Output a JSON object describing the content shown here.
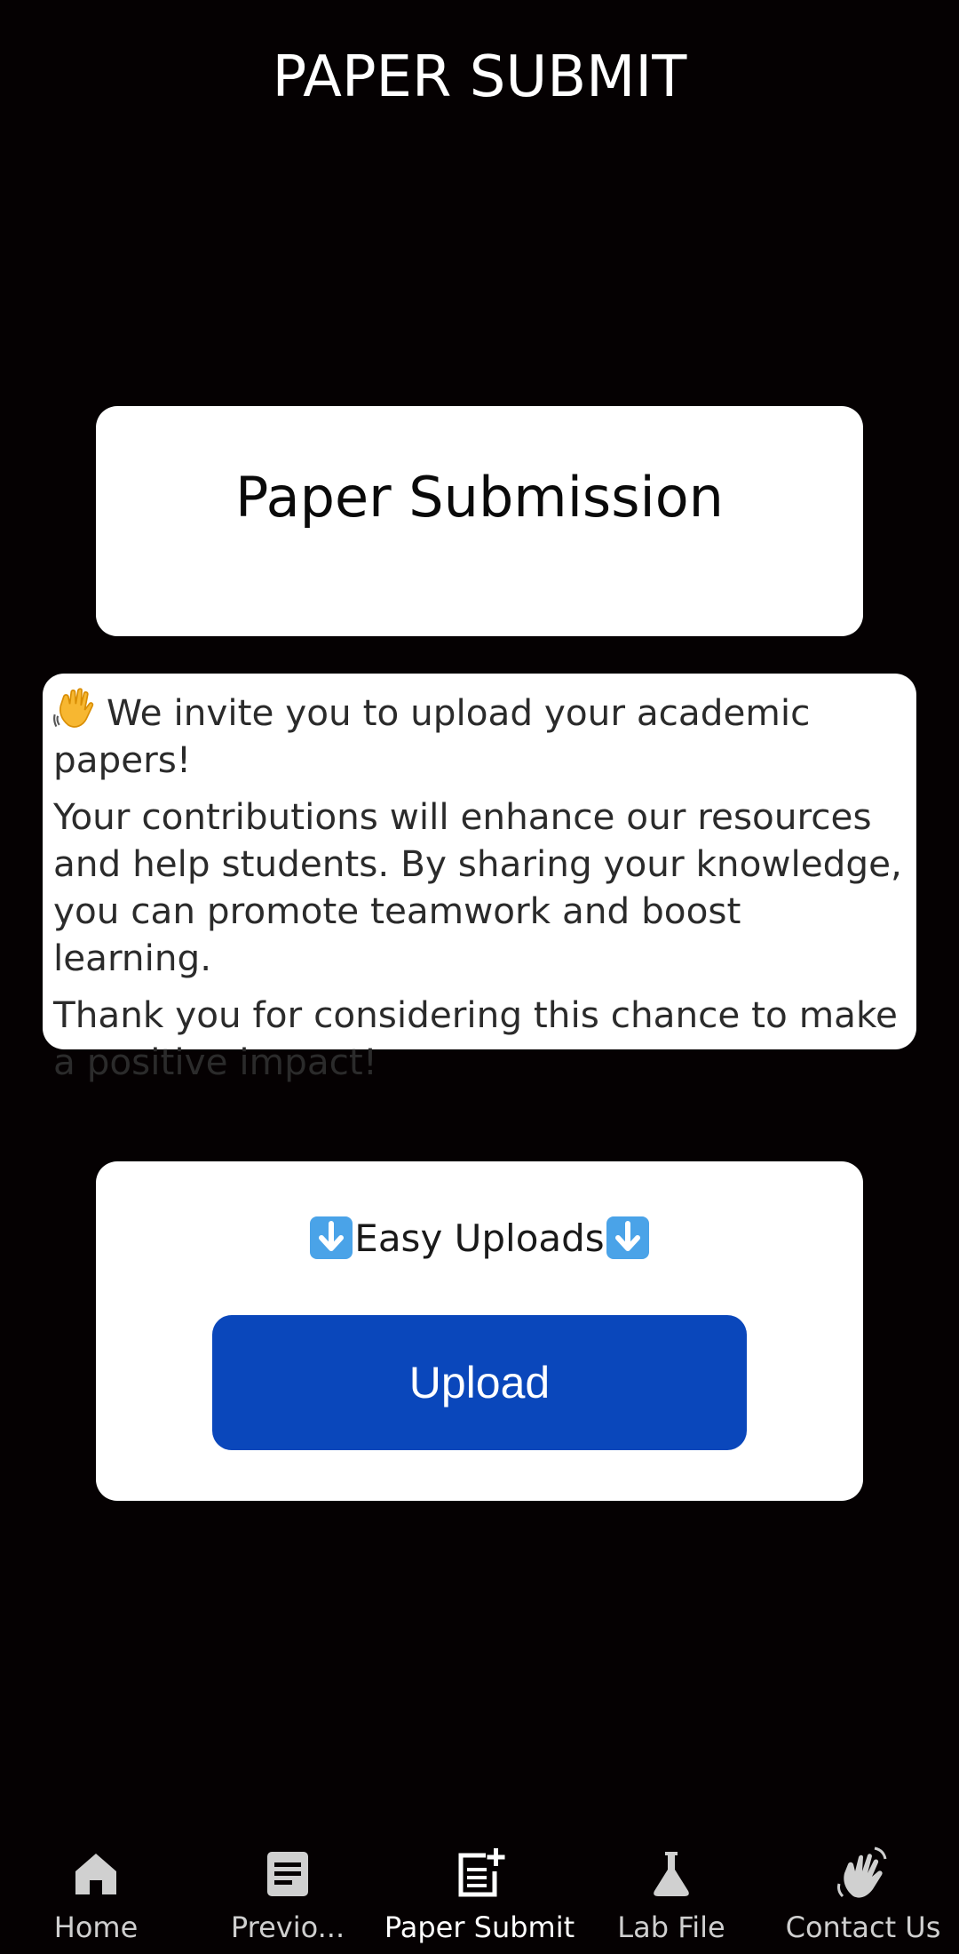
{
  "header": {
    "title": "PAPER SUBMIT"
  },
  "title_card": {
    "title": "Paper Submission"
  },
  "info_card": {
    "icon": "waving-hand-icon",
    "line1": "We invite you to upload your academic papers!",
    "line2": "Your contributions will enhance our resources and help students. By sharing your knowledge, you can promote teamwork and boost learning.",
    "line3": "Thank you for considering this chance to make a positive impact!"
  },
  "upload_card": {
    "heading": "Easy Uploads",
    "heading_icon": "down-arrow-icon",
    "button_label": "Upload",
    "button_color": "#0a47bb"
  },
  "bottom_nav": {
    "items": [
      {
        "label": "Home",
        "icon": "home-icon",
        "active": false
      },
      {
        "label": "Previo...",
        "icon": "document-icon",
        "active": false
      },
      {
        "label": "Paper Submit",
        "icon": "post-add-icon",
        "active": true
      },
      {
        "label": "Lab File",
        "icon": "flask-icon",
        "active": false
      },
      {
        "label": "Contact Us",
        "icon": "waving-hand-icon",
        "active": false
      }
    ]
  },
  "colors": {
    "background": "#050102",
    "card": "#ffffff",
    "accent": "#0a47bb"
  }
}
